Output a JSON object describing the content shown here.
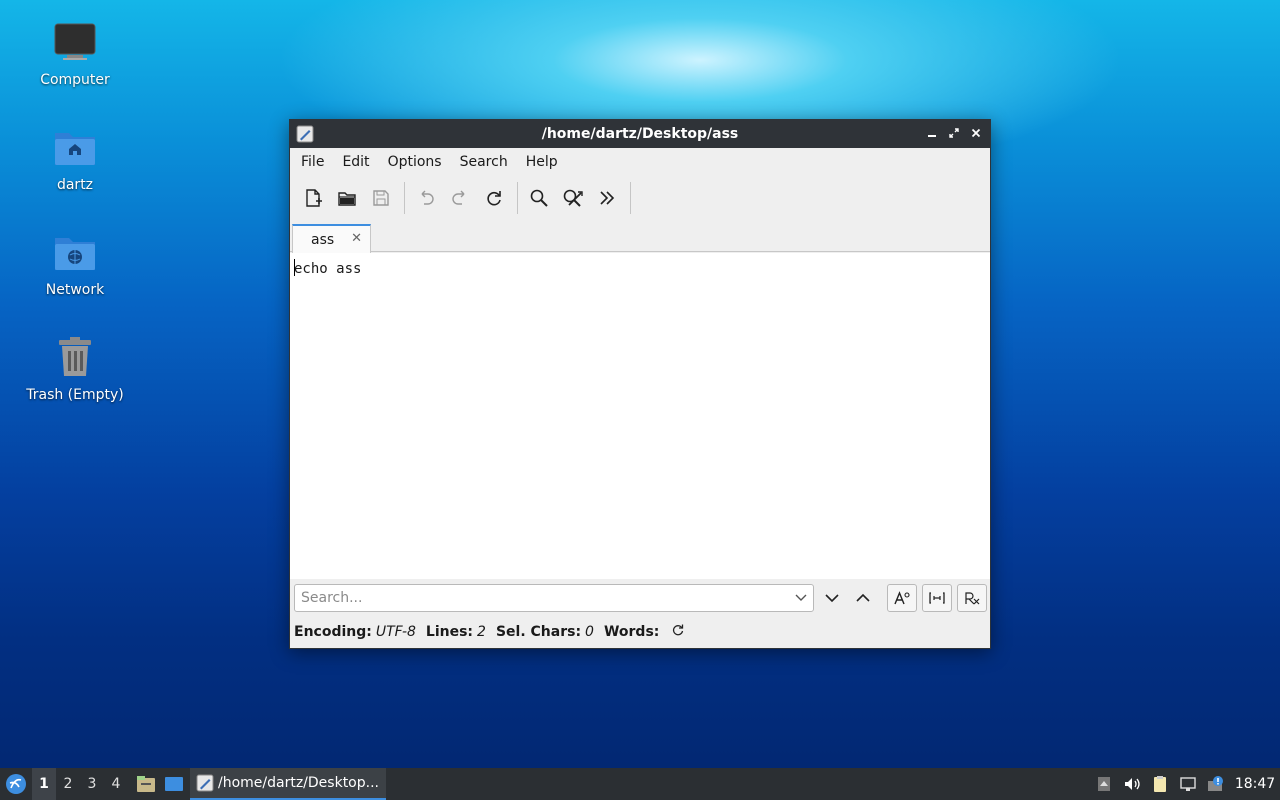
{
  "desktop": {
    "icons": [
      {
        "label": "Computer",
        "icon": "monitor-icon"
      },
      {
        "label": "dartz",
        "icon": "home-folder-icon"
      },
      {
        "label": "Network",
        "icon": "network-folder-icon"
      },
      {
        "label": "Trash (Empty)",
        "icon": "trash-icon"
      }
    ]
  },
  "window": {
    "title": "/home/dartz/Desktop/ass",
    "menu": [
      "File",
      "Edit",
      "Options",
      "Search",
      "Help"
    ],
    "toolbar": [
      "new-file-icon",
      "open-folder-icon",
      "save-icon",
      "undo-icon",
      "redo-icon",
      "reload-icon",
      "search-icon",
      "replace-icon",
      "more-icon"
    ],
    "tab": {
      "label": "ass",
      "close": "✕"
    },
    "editor": {
      "text": "echo ass"
    },
    "search": {
      "placeholder": "Search..."
    },
    "status": {
      "encoding_label": "Encoding:",
      "encoding_value": "UTF-8",
      "lines_label": "Lines:",
      "lines_value": "2",
      "sel_label": "Sel. Chars:",
      "sel_value": "0",
      "words_label": "Words:"
    }
  },
  "taskbar": {
    "workspaces": [
      "1",
      "2",
      "3",
      "4"
    ],
    "task_label": "/home/dartz/Desktop...",
    "clock": "18:47"
  },
  "colors": {
    "accent": "#3d8ee0",
    "titlebar": "#2f3338",
    "taskbar": "#2b2f33"
  }
}
